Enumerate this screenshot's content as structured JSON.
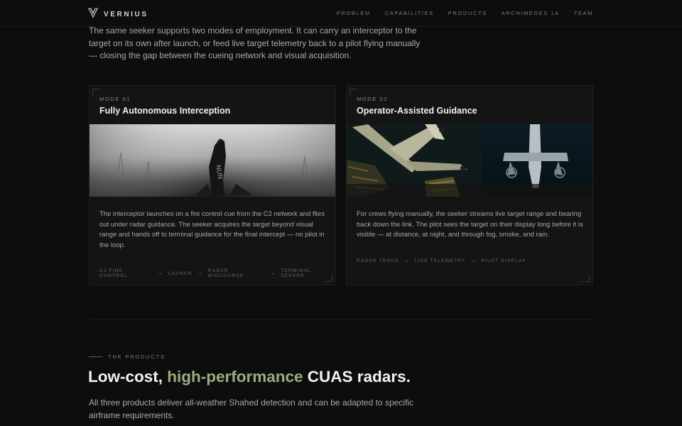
{
  "nav": {
    "brand": "VERNIUS",
    "links": [
      "PROBLEM",
      "CAPABILITIES",
      "PRODUCTS",
      "ARCHIMEDES 1A",
      "TEAM"
    ]
  },
  "intro": "The same seeker supports two modes of employment. It can carry an interceptor to the target on its own after launch, or feed live target telemetry back to a pilot flying manually — closing the gap between the cueing network and visual acquisition.",
  "modes": [
    {
      "label": "MODE 01",
      "title": "Fully Autonomous Interception",
      "description": "The interceptor launches on a fire control cue from the C2 network and flies out under radar guidance. The seeker acquires the target beyond visual range and hands off to terminal guidance for the final intercept — no pilot in the loop.",
      "flow": [
        "C2 FIRE CONTROL",
        "LAUNCH",
        "RADAR MIDCOURSE",
        "TERMINAL SEEKER"
      ]
    },
    {
      "label": "MODE 02",
      "title": "Operator-Assisted Guidance",
      "description": "For crews flying manually, the seeker streams live target range and bearing back down the link. The pilot sees the target on their display long before it is visible — at distance, at night, and through fog, smoke, and rain.",
      "flow": [
        "RADAR TRACK",
        "LIVE TELEMETRY",
        "PILOT DISPLAY"
      ]
    }
  ],
  "products": {
    "eyebrow": "THE PRODUCTS",
    "headline_pre": "Low-cost, ",
    "headline_accent": "high-performance",
    "headline_post": " CUAS radars.",
    "subtitle": "All three products deliver all-weather Shahed detection and can be adapted to specific airframe requirements."
  },
  "colors": {
    "accent": "#9aae80",
    "background": "#0d0d0d",
    "card": "#141414"
  }
}
